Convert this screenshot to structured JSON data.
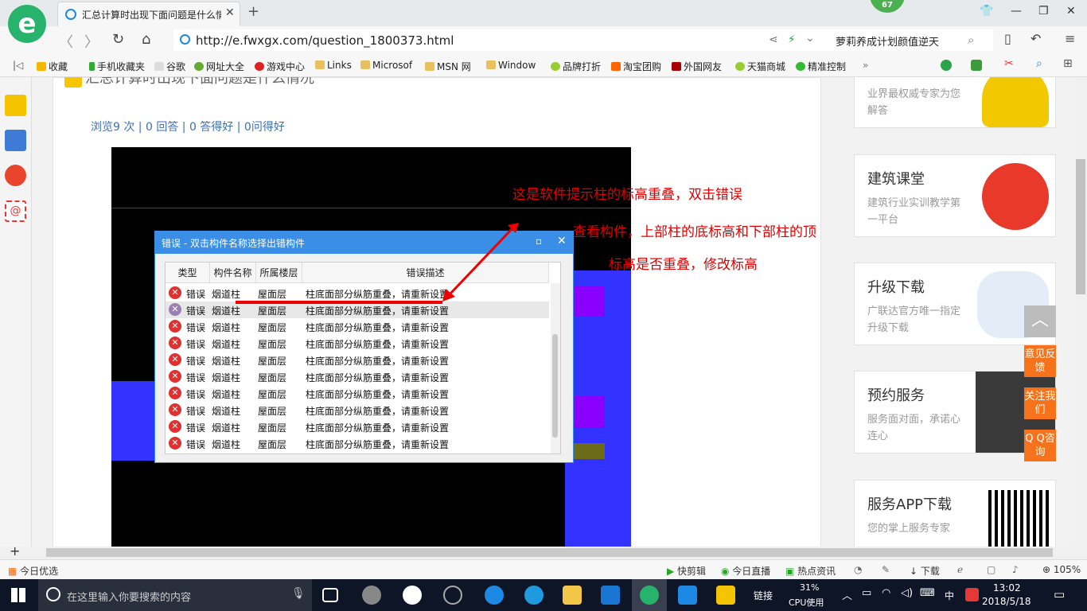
{
  "browser": {
    "tab_title": "汇总计算时出现下面问题是什么情况",
    "badge": "67",
    "url": "http://e.fwxgx.com/question_1800373.html",
    "search_hint": "萝莉养成计划颜值逆天",
    "logo_letter": "e"
  },
  "bookmarks": [
    "收藏",
    "手机收藏夹",
    "谷歌",
    "网址大全",
    "游戏中心",
    "Links",
    "Microsof",
    "MSN 网",
    "Window",
    "品牌打折",
    "淘宝团购",
    "外国网友",
    "天猫商城",
    "精准控制"
  ],
  "question": {
    "title": "汇总计算时出现下面问题是什么情况",
    "stats": "浏览9 次 | 0 回答 | 0 答得好 | 0问得好"
  },
  "dialog": {
    "title": "错误 - 双击构件名称选择出错构件",
    "headers": [
      "类型",
      "构件名称",
      "所属楼层",
      "错误描述"
    ],
    "rows": [
      {
        "type": "错误",
        "name": "烟道柱",
        "floor": "屋面层",
        "desc": "柱底面部分纵筋重叠，请重新设置"
      },
      {
        "type": "错误",
        "name": "烟道柱",
        "floor": "屋面层",
        "desc": "柱底面部分纵筋重叠，请重新设置"
      },
      {
        "type": "错误",
        "name": "烟道柱",
        "floor": "屋面层",
        "desc": "柱底面部分纵筋重叠，请重新设置"
      },
      {
        "type": "错误",
        "name": "烟道柱",
        "floor": "屋面层",
        "desc": "柱底面部分纵筋重叠，请重新设置"
      },
      {
        "type": "错误",
        "name": "烟道柱",
        "floor": "屋面层",
        "desc": "柱底面部分纵筋重叠，请重新设置"
      },
      {
        "type": "错误",
        "name": "烟道柱",
        "floor": "屋面层",
        "desc": "柱底面部分纵筋重叠，请重新设置"
      },
      {
        "type": "错误",
        "name": "烟道柱",
        "floor": "屋面层",
        "desc": "柱底面部分纵筋重叠，请重新设置"
      },
      {
        "type": "错误",
        "name": "烟道柱",
        "floor": "屋面层",
        "desc": "柱底面部分纵筋重叠，请重新设置"
      },
      {
        "type": "错误",
        "name": "烟道柱",
        "floor": "屋面层",
        "desc": "柱底面部分纵筋重叠，请重新设置"
      },
      {
        "type": "错误",
        "name": "烟道柱",
        "floor": "屋面层",
        "desc": "柱底面部分纵筋重叠，请重新设置"
      }
    ]
  },
  "annotation": {
    "line1": "这是软件提示柱的标高重叠，双击错误",
    "line2": "查看构件，上部柱的底标高和下部柱的顶",
    "line3": "标高是否重叠，修改标高"
  },
  "sidebar_cards": [
    {
      "title": "",
      "sub": "业界最权威专家为您解答"
    },
    {
      "title": "建筑课堂",
      "sub": "建筑行业实训教学第一平台"
    },
    {
      "title": "升级下载",
      "sub": "广联达官方唯一指定升级下载"
    },
    {
      "title": "预约服务",
      "sub": "服务面对面，承诺心连心"
    },
    {
      "title": "服务APP下载",
      "sub": "您的掌上服务专家"
    }
  ],
  "float_buttons": [
    "意见反馈",
    "关注我们",
    "Q Q咨询"
  ],
  "statusbar": {
    "left": "今日优选",
    "items": [
      "快剪辑",
      "今日直播",
      "热点资讯",
      "下载"
    ],
    "zoom": "105%"
  },
  "taskbar": {
    "search_placeholder": "在这里输入你要搜索的内容",
    "link_label": "链接",
    "cpu_percent": "31%",
    "cpu_label": "CPU使用",
    "ime": "中",
    "time": "13:02",
    "date": "2018/5/18"
  }
}
